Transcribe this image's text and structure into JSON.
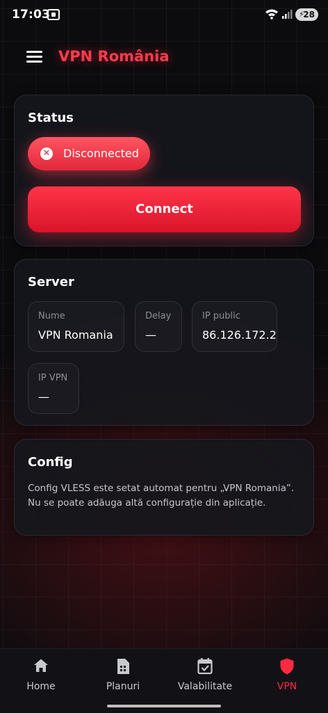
{
  "status_bar": {
    "time": "17:03",
    "battery": "28"
  },
  "app": {
    "title": "VPN România"
  },
  "status_card": {
    "title": "Status",
    "state_label": "Disconnected",
    "connect_label": "Connect",
    "colors": {
      "accent": "#ff3549",
      "pill": "#ff5563"
    }
  },
  "server_card": {
    "title": "Server",
    "fields": [
      {
        "label": "Nume",
        "value": "VPN Romania"
      },
      {
        "label": "Delay",
        "value": "—"
      },
      {
        "label": "IP public",
        "value": "86.126.172.2"
      },
      {
        "label": "IP VPN",
        "value": "—"
      }
    ]
  },
  "config_card": {
    "title": "Config",
    "text": "Config VLESS este setat automat pentru „VPN Romania”. Nu se poate adăuga altă configurație din aplicație."
  },
  "bottom_nav": {
    "items": [
      {
        "label": "Home",
        "icon": "home-icon"
      },
      {
        "label": "Planuri",
        "icon": "sim-card-icon"
      },
      {
        "label": "Valabilitate",
        "icon": "calendar-check-icon"
      },
      {
        "label": "VPN",
        "icon": "shield-icon",
        "active": true
      }
    ]
  }
}
